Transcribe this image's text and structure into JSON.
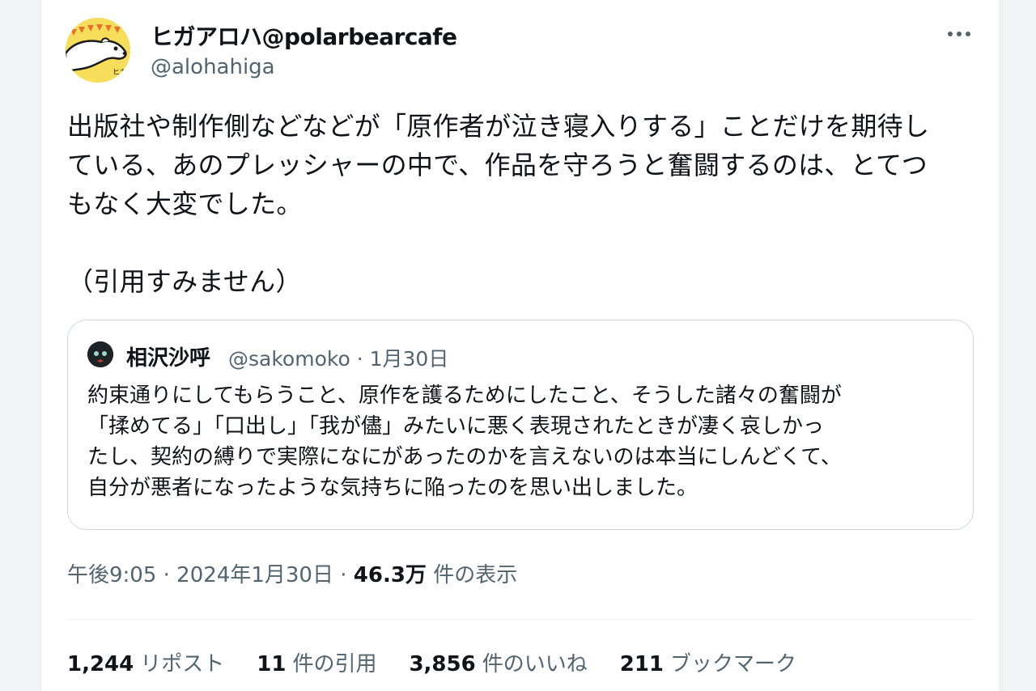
{
  "tweet": {
    "display_name": "ヒガアロハ@polarbearcafe",
    "handle": "@alohahiga",
    "avatar_icon": "polar-bear-avatar-icon",
    "more_icon": "more-options-icon",
    "text": "出版社や制作側などなどが「原作者が泣き寝入りする」ことだけを期待し\nている、あのプレッシャーの中で、作品を守ろうと奮闘するのは、とてつ\nもなく大変でした。\n\n（引用すみません）",
    "timestamp": "午後9:05 · 2024年1月30日 · ",
    "views_count": "46.3万",
    "views_label": " 件の表示"
  },
  "quote": {
    "name": "相沢沙呼",
    "meta": "@sakomoko · 1月30日",
    "text": "約束通りにしてもらうこと、原作を護るためにしたこと、そうした諸々の奮闘が\n「揉めてる」「口出し」「我が儘」みたいに悪く表現されたときが凄く哀しかっ\nたし、契約の縛りで実際になにがあったのかを言えないのは本当にしんどくて、\n自分が悪者になったような気持ちに陥ったのを思い出しました。"
  },
  "stats": [
    {
      "count": "1,244",
      "label": "リポスト"
    },
    {
      "count": "11",
      "label": "件の引用"
    },
    {
      "count": "3,856",
      "label": "件のいいね"
    },
    {
      "count": "211",
      "label": "ブックマーク"
    }
  ],
  "colors": {
    "text": "#0f1419",
    "secondary": "#536471",
    "border": "#cfd9de",
    "avatar_bg": "#f7de5a"
  }
}
